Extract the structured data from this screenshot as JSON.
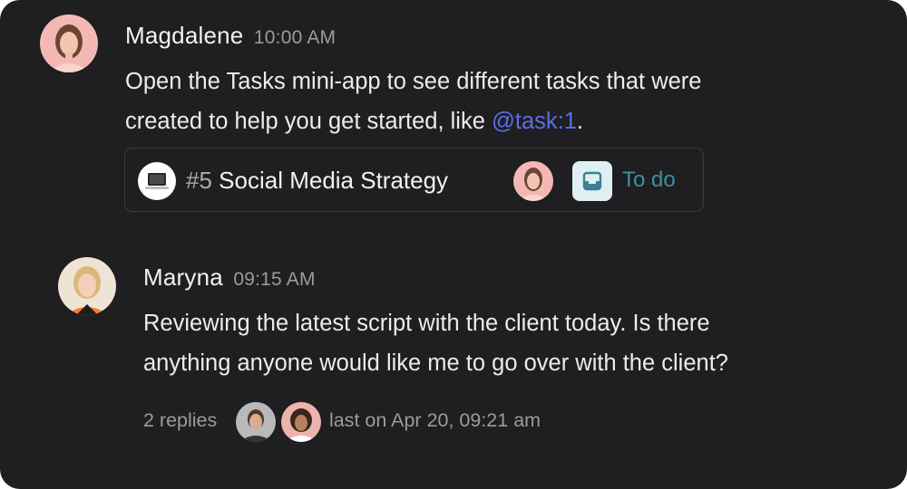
{
  "messages": [
    {
      "author": "Magdalene",
      "time": "10:00 AM",
      "line1": "Open the Tasks mini-app to see different tasks that were",
      "line2_prefix": "created to help you get started, like ",
      "mention": "@task:1",
      "line2_suffix": ".",
      "avatar": "magdalene-avatar"
    },
    {
      "author": "Maryna",
      "time": "09:15 AM",
      "line1": "Reviewing the latest script with the client today. Is there",
      "line2": "anything anyone would like me to go over with the client?",
      "avatar": "maryna-avatar"
    }
  ],
  "task_card": {
    "number": "#5",
    "title": "Social Media Strategy",
    "status": "To do",
    "icon": "laptop-icon",
    "status_icon": "inbox-tray-icon"
  },
  "thread": {
    "replies": "2 replies",
    "last": "last on Apr 20, 09:21 am"
  },
  "colors": {
    "background": "#1f1e20",
    "mention": "#5b6ee8",
    "status": "#3f8fa3",
    "status_bg": "#dff0f3"
  }
}
